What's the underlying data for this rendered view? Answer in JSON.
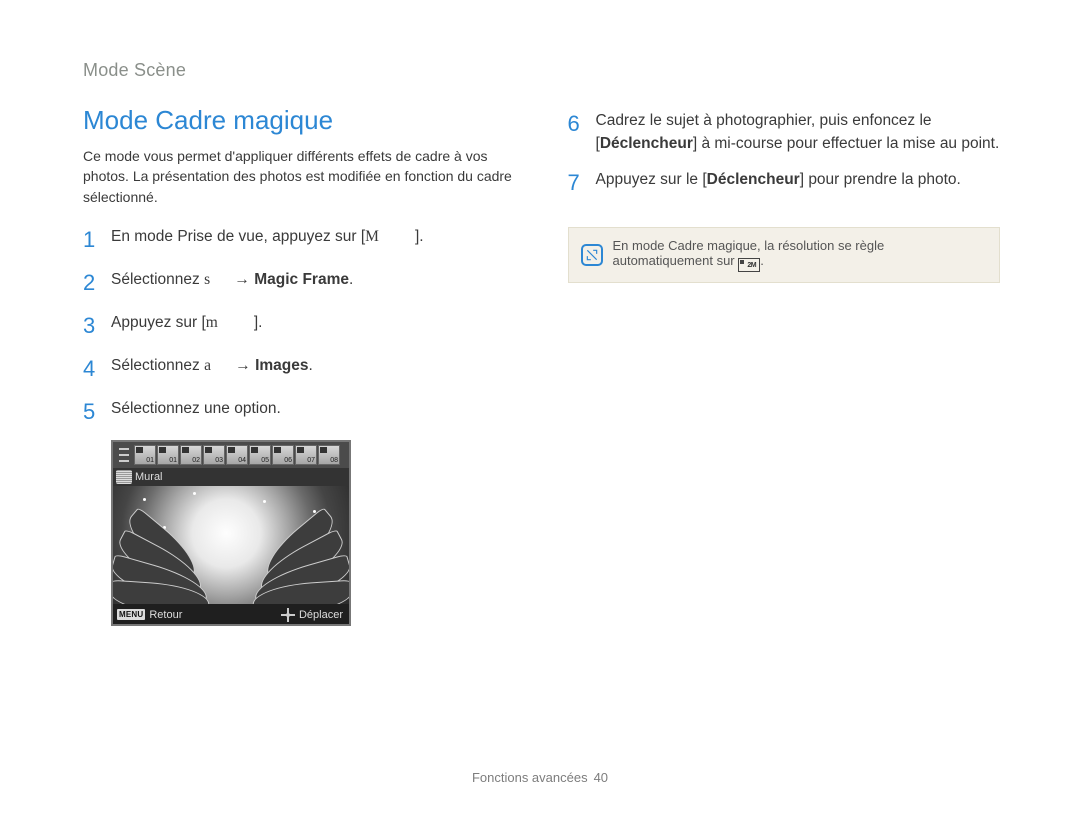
{
  "breadcrumb": "Mode Scène",
  "heading": "Mode Cadre magique",
  "intro": "Ce mode vous permet d'appliquer différents effets de cadre à vos photos. La présentation des photos est modifiée en fonction du cadre sélectionné.",
  "steps_left": [
    {
      "n": "1",
      "pre": "En mode Prise de vue, appuyez sur [",
      "glyph": "M",
      "post": "]."
    },
    {
      "n": "2",
      "pre": "Sélectionnez ",
      "glyph": "s",
      "arrow": " → ",
      "target": "Magic Frame",
      "post": "."
    },
    {
      "n": "3",
      "pre": "Appuyez sur [",
      "glyph": "m",
      "post": "]."
    },
    {
      "n": "4",
      "pre": "Sélectionnez ",
      "glyph": "a",
      "arrow": " → ",
      "target": "Images",
      "post": "."
    },
    {
      "n": "5",
      "pre": "Sélectionnez une option."
    }
  ],
  "screenshot": {
    "thumbs": [
      "01",
      "01",
      "02",
      "03",
      "04",
      "05",
      "06",
      "07",
      "08"
    ],
    "label": "Mural",
    "footer_left": "Retour",
    "footer_menu": "MENU",
    "footer_right": "Déplacer"
  },
  "steps_right": [
    {
      "n": "6",
      "pre": "Cadrez le sujet à photographier, puis enfoncez le [",
      "bold": "Déclencheur",
      "post": "] à mi-course pour effectuer la mise au point."
    },
    {
      "n": "7",
      "pre": "Appuyez sur le [",
      "bold": "Déclencheur",
      "post": "] pour prendre la photo."
    }
  ],
  "note": {
    "text_pre": "En mode Cadre magique, la résolution se règle automatiquement sur ",
    "res": "2M",
    "text_post": "."
  },
  "footer": {
    "label": "Fonctions avancées",
    "page": "40"
  }
}
